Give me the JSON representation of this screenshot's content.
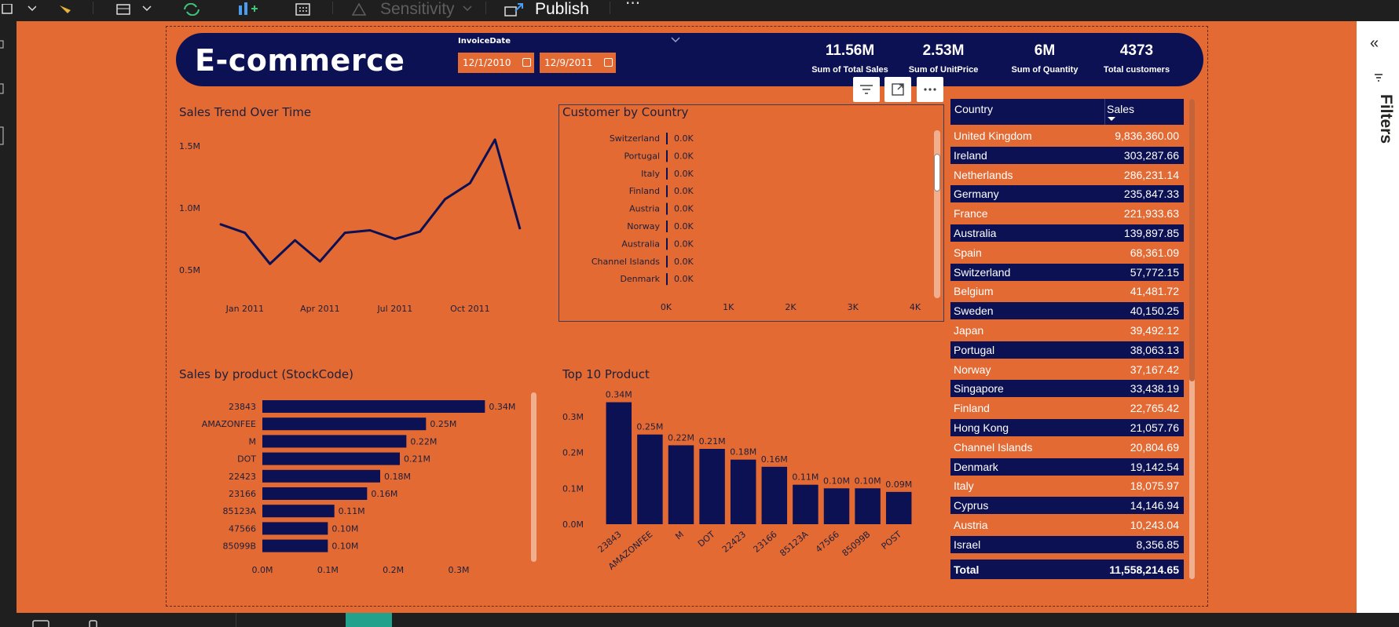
{
  "toolbar": {
    "sensitivity_label": "Sensitivity",
    "publish_label": "Publish",
    "more_label": "···"
  },
  "filters_pane": {
    "label": "Filters",
    "collapse_glyph": "«"
  },
  "report": {
    "title": "E-commerce",
    "slicer": {
      "label": "InvoiceDate",
      "start": "12/1/2010",
      "end": "12/9/2011"
    },
    "kpis": [
      {
        "value": "11.56M",
        "label": "Sum of Total Sales"
      },
      {
        "value": "2.53M",
        "label": "Sum of UnitPrice"
      },
      {
        "value": "6M",
        "label": "Sum of Quantity"
      },
      {
        "value": "4373",
        "label": "Total customers"
      }
    ]
  },
  "colors": {
    "canvas": "#e46a34",
    "navy": "#0b1152",
    "row_dark": "#0b1152"
  },
  "chart_data": [
    {
      "id": "sales-trend",
      "type": "line",
      "title": "Sales Trend Over Time",
      "x": [
        "Dec 2010",
        "Jan 2011",
        "Feb 2011",
        "Mar 2011",
        "Apr 2011",
        "May 2011",
        "Jun 2011",
        "Jul 2011",
        "Aug 2011",
        "Sep 2011",
        "Oct 2011",
        "Nov 2011",
        "Dec 2011"
      ],
      "values": [
        0.87,
        0.8,
        0.55,
        0.74,
        0.57,
        0.8,
        0.82,
        0.75,
        0.81,
        1.07,
        1.2,
        1.55,
        0.83
      ],
      "xticks": [
        "Jan 2011",
        "Apr 2011",
        "Jul 2011",
        "Oct 2011"
      ],
      "yticks": [
        "0.5M",
        "1.0M",
        "1.5M"
      ],
      "ylim": [
        0.4,
        1.6
      ]
    },
    {
      "id": "customer-country",
      "type": "bar",
      "title": "Customer by Country",
      "categories": [
        "Switzerland",
        "Portugal",
        "Italy",
        "Finland",
        "Austria",
        "Norway",
        "Australia",
        "Channel Islands",
        "Denmark"
      ],
      "values": [
        0,
        0,
        0,
        0,
        0,
        0,
        0,
        0,
        0
      ],
      "data_labels": [
        "0.0K",
        "0.0K",
        "0.0K",
        "0.0K",
        "0.0K",
        "0.0K",
        "0.0K",
        "0.0K",
        "0.0K"
      ],
      "xticks": [
        "0K",
        "1K",
        "2K",
        "3K",
        "4K"
      ],
      "xlim": [
        0,
        4000
      ]
    },
    {
      "id": "sales-by-product",
      "type": "bar",
      "title": "Sales by product (StockCode)",
      "categories": [
        "23843",
        "AMAZONFEE",
        "M",
        "DOT",
        "22423",
        "23166",
        "85123A",
        "47566",
        "85099B"
      ],
      "values": [
        0.34,
        0.25,
        0.22,
        0.21,
        0.18,
        0.16,
        0.11,
        0.1,
        0.1
      ],
      "data_labels": [
        "0.34M",
        "0.25M",
        "0.22M",
        "0.21M",
        "0.18M",
        "0.16M",
        "0.11M",
        "0.10M",
        "0.10M"
      ],
      "xticks": [
        "0.0M",
        "0.1M",
        "0.2M",
        "0.3M"
      ],
      "xlim": [
        0,
        0.39
      ]
    },
    {
      "id": "top-10-product",
      "type": "bar",
      "title": "Top 10 Product",
      "categories": [
        "23843",
        "AMAZONFEE",
        "M",
        "DOT",
        "22423",
        "23166",
        "85123A",
        "47566",
        "85099B",
        "POST"
      ],
      "values": [
        0.34,
        0.25,
        0.22,
        0.21,
        0.18,
        0.16,
        0.11,
        0.1,
        0.1,
        0.09
      ],
      "data_labels": [
        "0.34M",
        "0.25M",
        "0.22M",
        "0.21M",
        "0.18M",
        "0.16M",
        "0.11M",
        "0.10M",
        "0.10M",
        "0.09M"
      ],
      "yticks": [
        "0.0M",
        "0.1M",
        "0.2M",
        "0.3M"
      ],
      "ylim": [
        0,
        0.35
      ]
    }
  ],
  "table": {
    "headers": [
      "Country",
      "Sales"
    ],
    "rows": [
      [
        "United Kingdom",
        "9,836,360.00"
      ],
      [
        "Ireland",
        "303,287.66"
      ],
      [
        "Netherlands",
        "286,231.14"
      ],
      [
        "Germany",
        "235,847.33"
      ],
      [
        "France",
        "221,933.63"
      ],
      [
        "Australia",
        "139,897.85"
      ],
      [
        "Spain",
        "68,361.09"
      ],
      [
        "Switzerland",
        "57,772.15"
      ],
      [
        "Belgium",
        "41,481.72"
      ],
      [
        "Sweden",
        "40,150.25"
      ],
      [
        "Japan",
        "39,492.12"
      ],
      [
        "Portugal",
        "38,063.13"
      ],
      [
        "Norway",
        "37,167.42"
      ],
      [
        "Singapore",
        "33,438.19"
      ],
      [
        "Finland",
        "22,765.42"
      ],
      [
        "Hong Kong",
        "21,057.76"
      ],
      [
        "Channel Islands",
        "20,804.69"
      ],
      [
        "Denmark",
        "19,142.54"
      ],
      [
        "Italy",
        "18,075.97"
      ],
      [
        "Cyprus",
        "14,146.94"
      ],
      [
        "Austria",
        "10,243.04"
      ],
      [
        "Israel",
        "8,356.85"
      ]
    ],
    "total_label": "Total",
    "total_value": "11,558,214.65"
  }
}
